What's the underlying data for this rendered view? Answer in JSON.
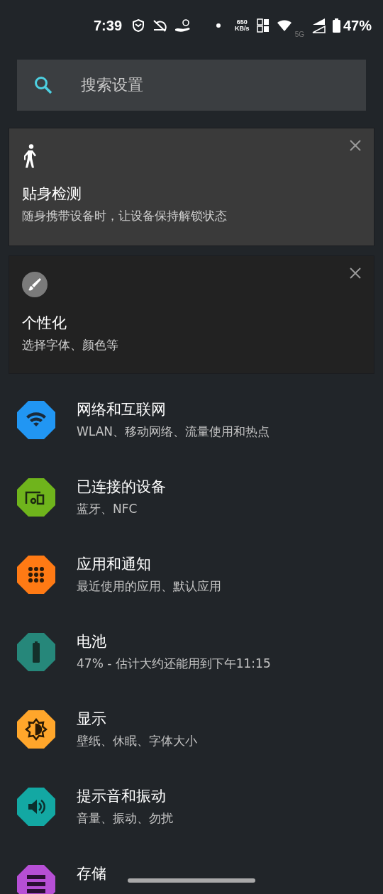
{
  "status_bar": {
    "time": "7:39",
    "speed_value": "650",
    "speed_unit": "KB/s",
    "network_type": "5G",
    "battery": "47%"
  },
  "search": {
    "placeholder": "搜索设置"
  },
  "suggestions": [
    {
      "kind": "walk",
      "title": "贴身检测",
      "subtitle": "随身携带设备时，让设备保持解锁状态",
      "highlighted": true
    },
    {
      "kind": "brush",
      "title": "个性化",
      "subtitle": "选择字体、颜色等",
      "highlighted": false
    }
  ],
  "settings": [
    {
      "kind": "wifi",
      "title": "网络和互联网",
      "subtitle": "WLAN、移动网络、流量使用和热点",
      "color": "#2196f3"
    },
    {
      "kind": "devices",
      "title": "已连接的设备",
      "subtitle": "蓝牙、NFC",
      "color": "#6fb41c"
    },
    {
      "kind": "apps",
      "title": "应用和通知",
      "subtitle": "最近使用的应用、默认应用",
      "color": "#ff7a14"
    },
    {
      "kind": "battery",
      "title": "电池",
      "subtitle": "47% - 估计大约还能用到下午11:15",
      "color": "#26877a"
    },
    {
      "kind": "display",
      "title": "显示",
      "subtitle": "壁纸、休眠、字体大小",
      "color": "#ffa62b"
    },
    {
      "kind": "sound",
      "title": "提示音和振动",
      "subtitle": "音量、振动、勿扰",
      "color": "#13a8a3"
    },
    {
      "kind": "storage",
      "title": "存储",
      "color": "#b64fd5"
    }
  ]
}
